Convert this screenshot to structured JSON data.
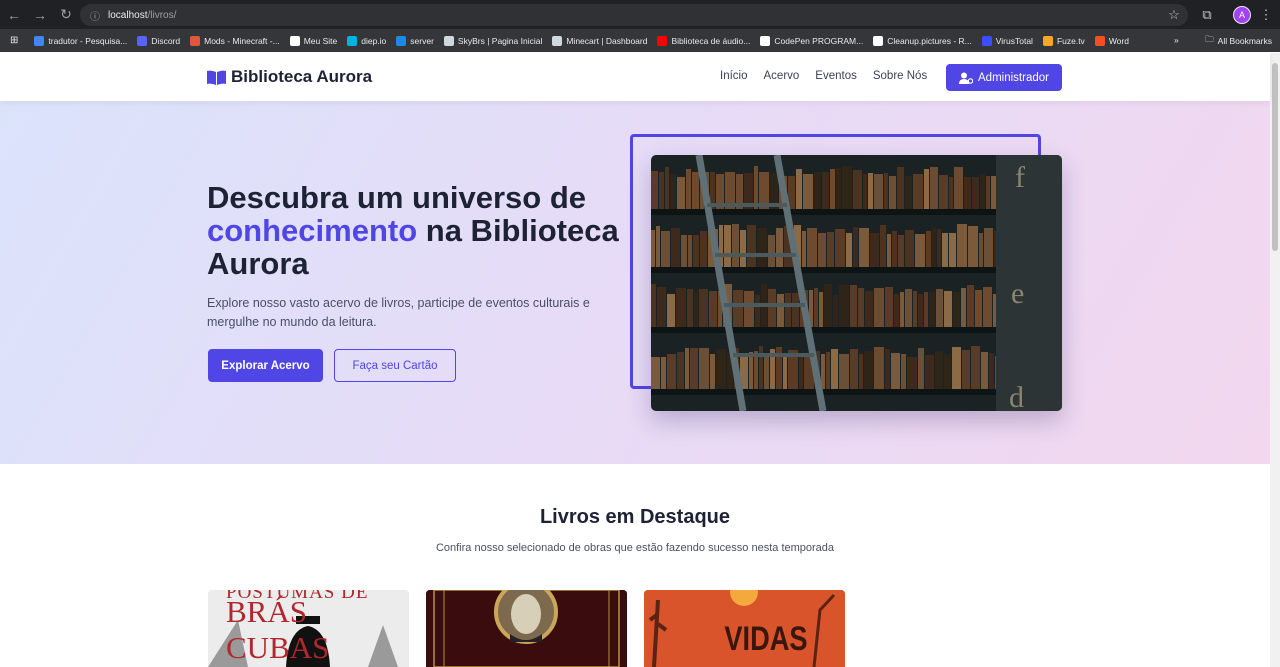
{
  "browser": {
    "url_host": "localhost",
    "url_path": "/livros/",
    "profile_initial": "A",
    "bookmarks": [
      {
        "label": "tradutor - Pesquisa...",
        "color": "#4285f4"
      },
      {
        "label": "Discord",
        "color": "#5865f2"
      },
      {
        "label": "Mods - Minecraft -...",
        "color": "#e0583c"
      },
      {
        "label": "Meu Site",
        "color": "#ffffff"
      },
      {
        "label": "diep.io",
        "color": "#00b2e1"
      },
      {
        "label": "server",
        "color": "#1e88e5"
      },
      {
        "label": "SkyBrs | Pagina Inicial",
        "color": "#cfd8dc"
      },
      {
        "label": "Minecart | Dashboard",
        "color": "#cfd8dc"
      },
      {
        "label": "Biblioteca de áudio...",
        "color": "#ff0000"
      },
      {
        "label": "CodePen PROGRAM...",
        "color": "#ffffff"
      },
      {
        "label": "Cleanup.pictures - R...",
        "color": "#ffffff"
      },
      {
        "label": "VirusTotal",
        "color": "#394eff"
      },
      {
        "label": "Fuze.tv",
        "color": "#f9a825"
      },
      {
        "label": "Word",
        "color": "#f25022"
      }
    ],
    "all_bookmarks": "All Bookmarks"
  },
  "header": {
    "logo": "Biblioteca Aurora",
    "nav": [
      "Início",
      "Acervo",
      "Eventos",
      "Sobre Nós"
    ],
    "admin_button": "Administrador"
  },
  "hero": {
    "title_part1": "Descubra um universo de ",
    "title_highlight": "conhecimento",
    "title_part2": " na Biblioteca Aurora",
    "subtitle": "Explore nosso vasto acervo de livros, participe de eventos culturais e mergulhe no mundo da leitura.",
    "primary_button": "Explorar Acervo",
    "secondary_button": "Faça seu Cartão"
  },
  "featured": {
    "title": "Livros em Destaque",
    "subtitle": "Confira nosso selecionado de obras que estão fazendo sucesso nesta temporada",
    "books": [
      {
        "cover_text_1": "PÓSTUMAS DE",
        "cover_text_2": "BRÁS CUBAS"
      },
      {
        "cover_text_1": ""
      },
      {
        "cover_text_1": "VIDAS"
      }
    ]
  },
  "colors": {
    "accent": "#4f46e5",
    "heading": "#1e2235"
  }
}
